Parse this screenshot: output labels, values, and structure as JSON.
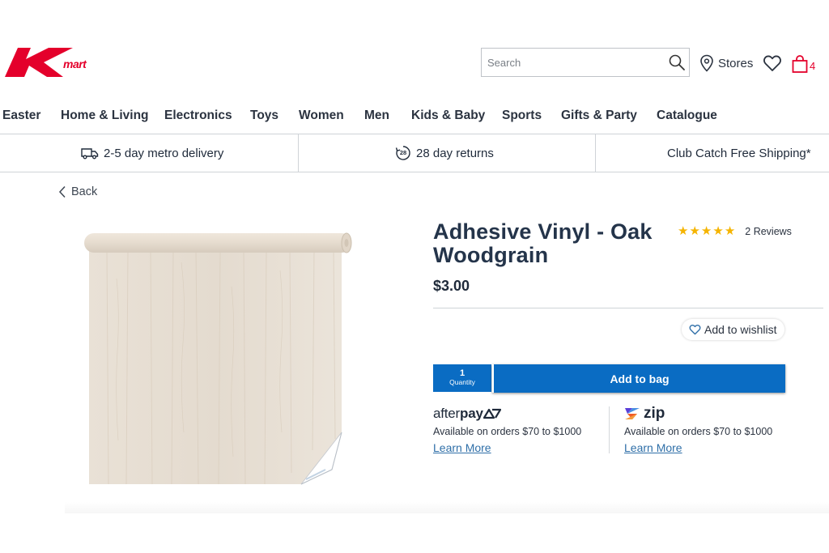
{
  "brand": {
    "logo_text": "Kmart",
    "color": "#e4002b"
  },
  "search": {
    "placeholder": "Search",
    "icon": "search-icon"
  },
  "header": {
    "stores_label": "Stores",
    "bag_count": "4"
  },
  "nav": {
    "items": [
      "Easter",
      "Home & Living",
      "Electronics",
      "Toys",
      "Women",
      "Men",
      "Kids & Baby",
      "Sports",
      "Gifts & Party",
      "Catalogue"
    ]
  },
  "usp": {
    "delivery": "2-5 day metro delivery",
    "returns": "28 day returns",
    "returns_badge": "28",
    "shipping": "Club Catch Free Shipping*"
  },
  "back_label": "Back",
  "product": {
    "title": "Adhesive Vinyl - Oak Woodgrain",
    "price": "$3.00",
    "rating": 5,
    "reviews": "2 Reviews",
    "wishlist_label": "Add to wishlist",
    "quantity": "1",
    "quantity_label": "Quantity",
    "add_to_bag": "Add to bag"
  },
  "payments": {
    "afterpay": {
      "logo_regular": "after",
      "logo_bold": "pay",
      "available": "Available on orders $70 to $1000",
      "learn_more": "Learn More"
    },
    "zip": {
      "logo": "zip",
      "available": "Available on orders $70 to $1000",
      "learn_more": "Learn More"
    }
  },
  "colors": {
    "primary_blue": "#0a6cc3",
    "brand_red": "#e4002b",
    "star": "#f5b400",
    "link": "#2f6fa8",
    "text": "#24344a"
  }
}
